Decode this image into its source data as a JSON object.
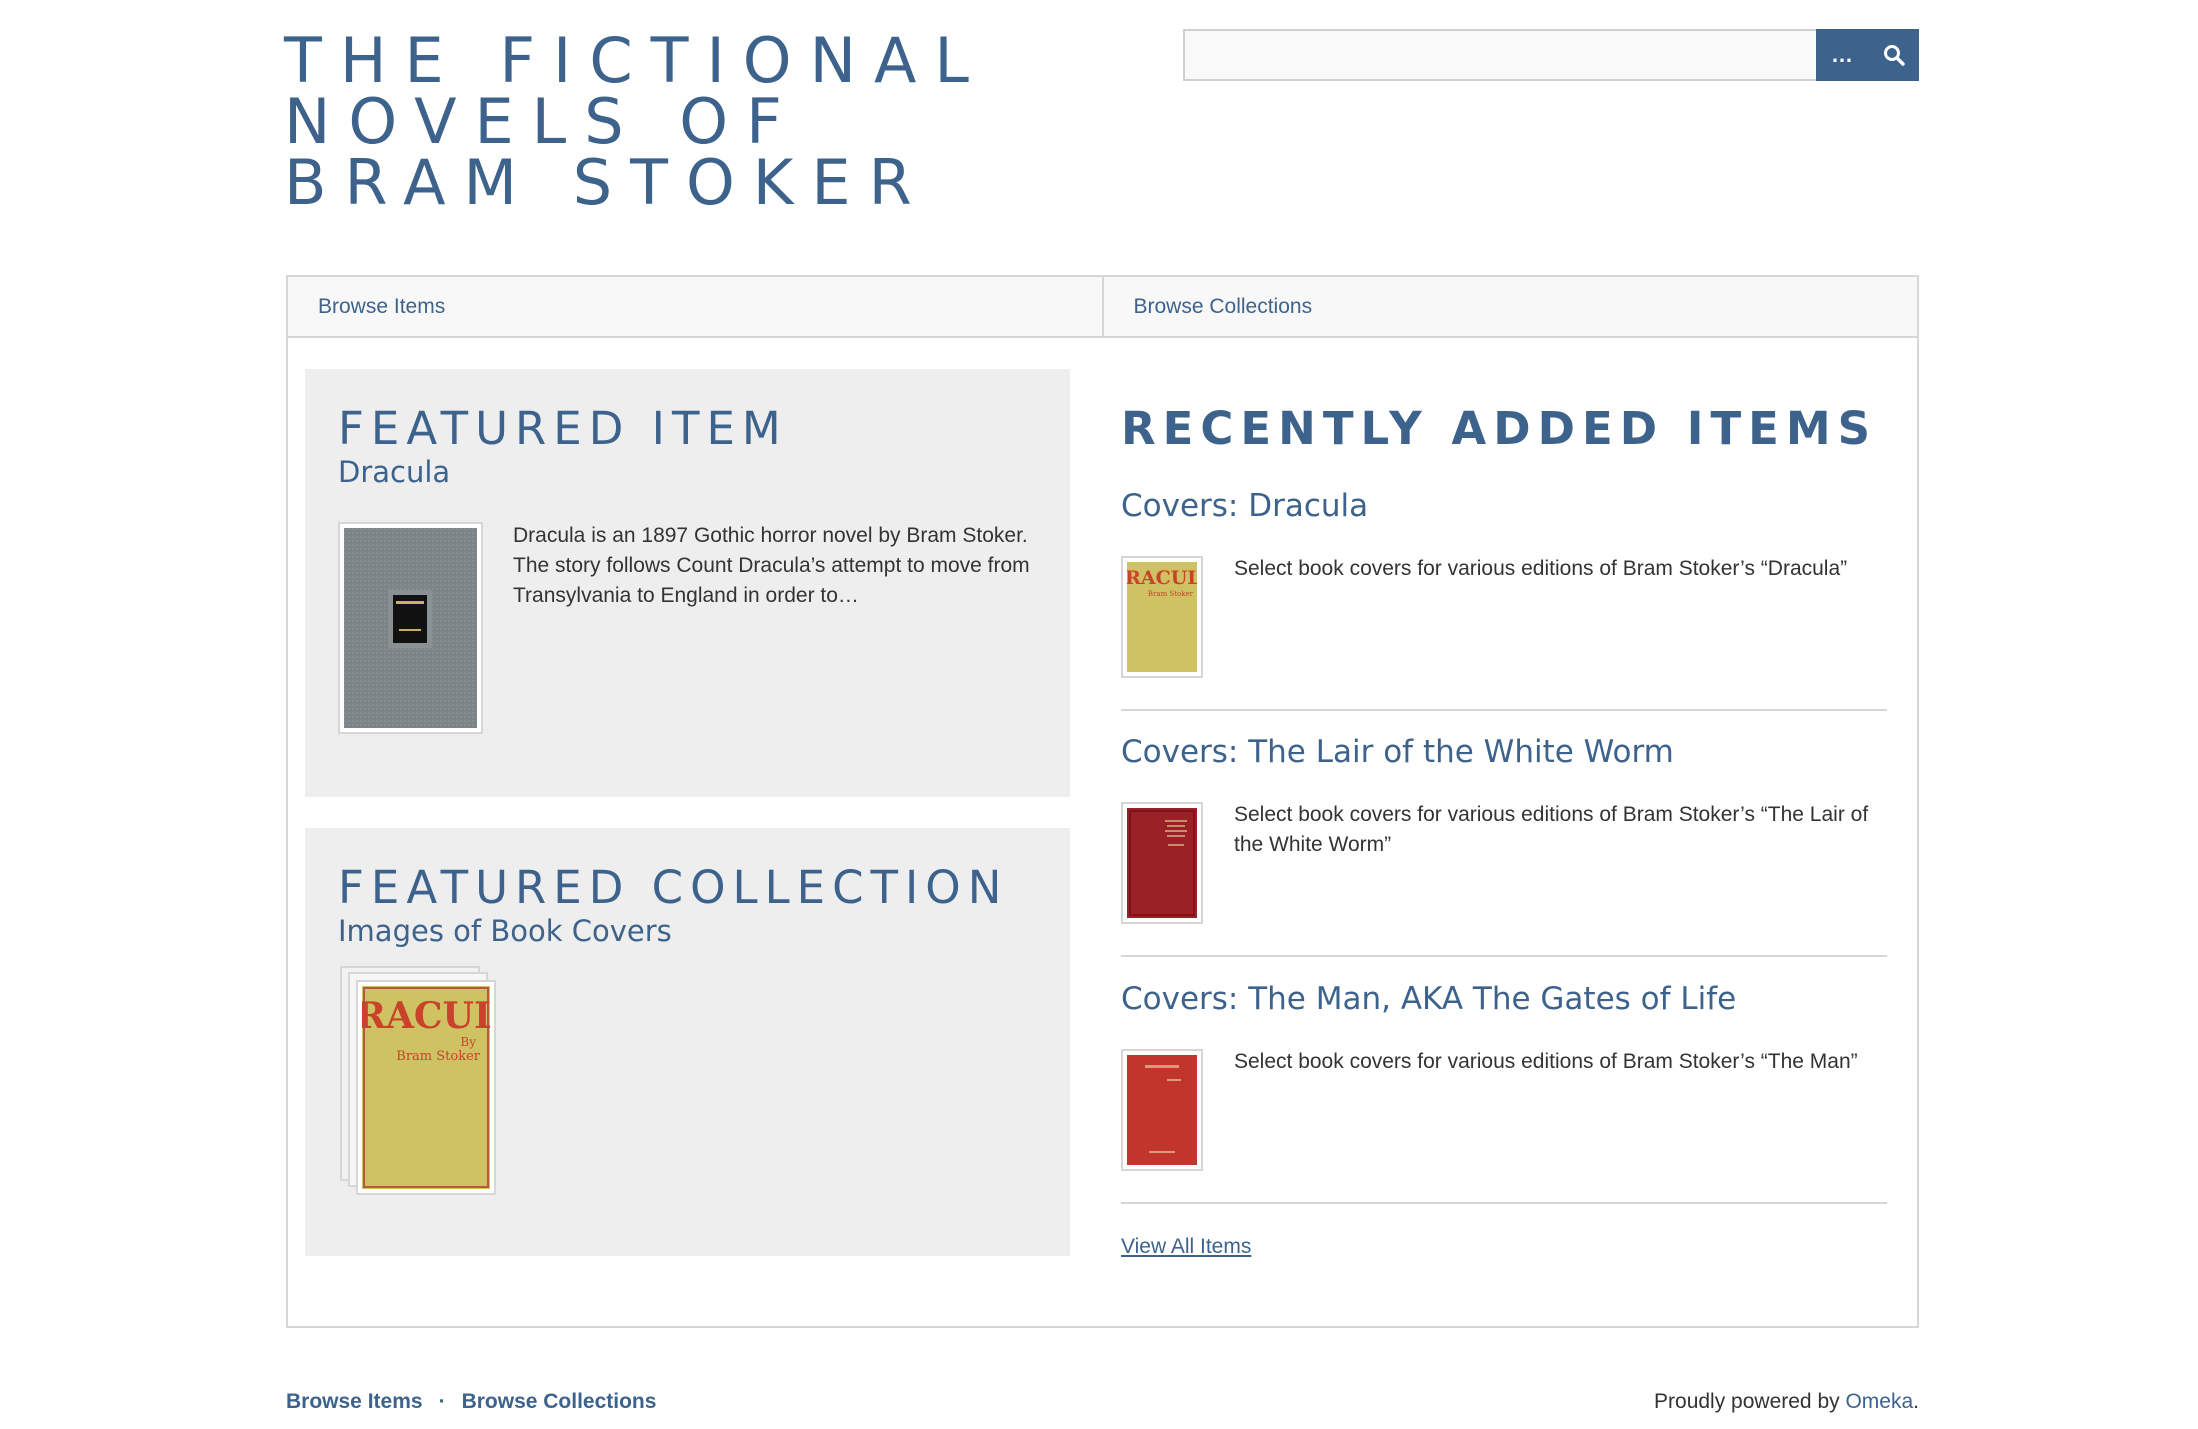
{
  "site": {
    "title": "The Fictional Novels of Bram Stoker"
  },
  "search": {
    "value": "",
    "options_label": "…"
  },
  "nav": {
    "items": [
      {
        "label": "Browse Items"
      },
      {
        "label": "Browse Collections"
      }
    ]
  },
  "featured_item": {
    "heading": "Featured Item",
    "title": "Dracula",
    "description": "Dracula is an 1897 Gothic horror novel by Bram Stoker. The story follows Count Dracula’s attempt to move from Transylvania to England in order to…"
  },
  "featured_collection": {
    "heading": "Featured Collection",
    "title": "Images of Book Covers"
  },
  "recent": {
    "heading": "Recently Added Items",
    "items": [
      {
        "title": "Covers: Dracula",
        "description": "Select book covers for various editions of Bram Stoker’s “Dracula”"
      },
      {
        "title": "Covers: The Lair of the White Worm",
        "description": "Select book covers for various editions of Bram Stoker’s “The Lair of the White Worm”"
      },
      {
        "title": "Covers: The Man, AKA The Gates of Life",
        "description": "Select book covers for various editions of Bram Stoker’s “The Man”"
      }
    ],
    "view_all_label": "View All Items"
  },
  "footer": {
    "nav": [
      {
        "label": "Browse Items"
      },
      {
        "label": "Browse Collections"
      }
    ],
    "separator": "·",
    "powered_prefix": "Proudly powered by ",
    "powered_link": "Omeka",
    "powered_suffix": "."
  },
  "covers": {
    "dracula_title": "DRACULA",
    "dracula_by": "By",
    "dracula_author": "Bram Stoker",
    "lair_text": "THE LAIR OF THE WHITE WORM",
    "man_text": "THE MAN"
  },
  "colors": {
    "accent": "#3d638d",
    "panel": "#eeeeee",
    "border": "#d6d6d6"
  }
}
